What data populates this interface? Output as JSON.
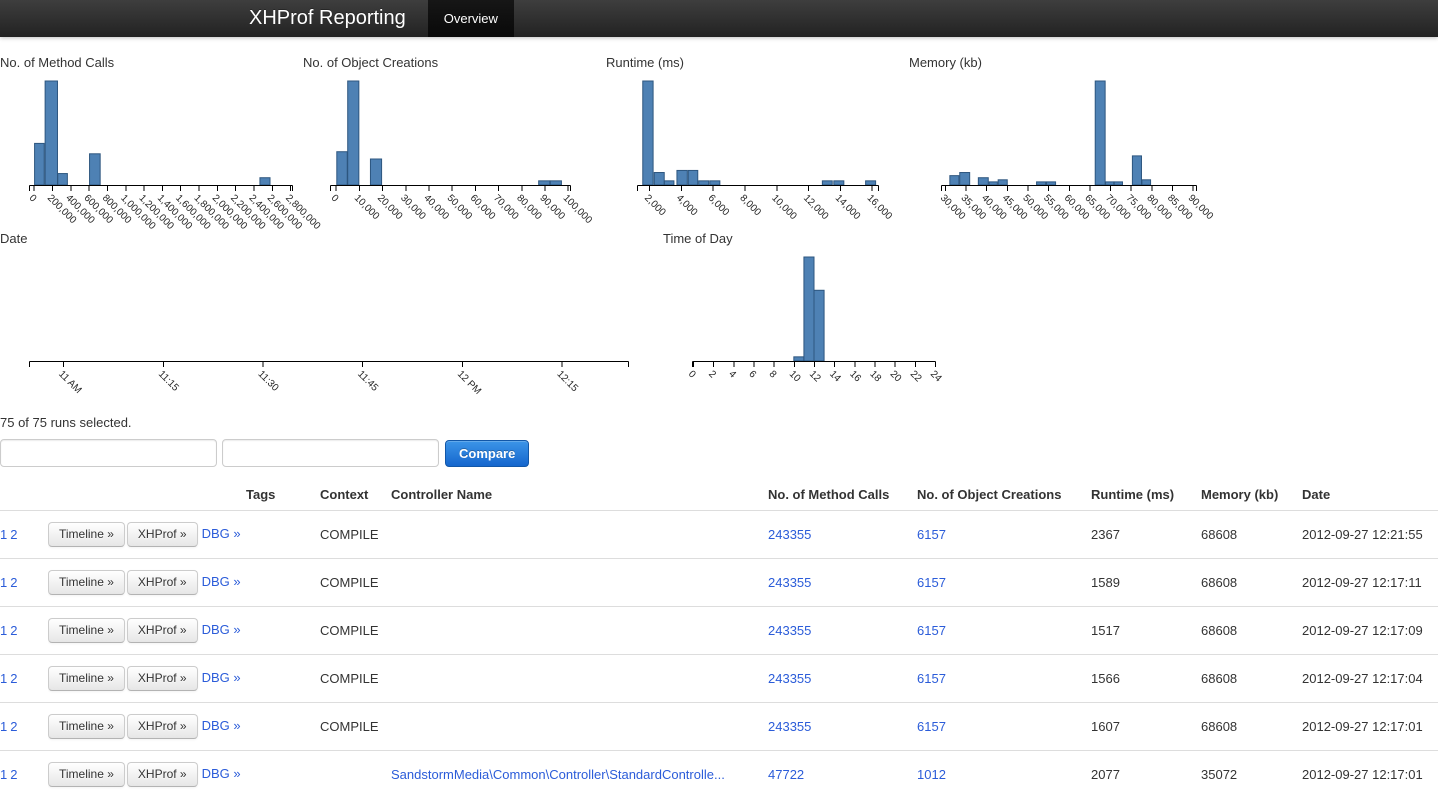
{
  "navbar": {
    "brand": "XHProf Reporting",
    "tabs": [
      {
        "label": "Overview",
        "active": true
      }
    ]
  },
  "selection": {
    "text": "75 of 75 runs selected.",
    "inputs": [
      {
        "value": ""
      },
      {
        "value": ""
      }
    ],
    "compare_label": "Compare"
  },
  "colors": {
    "bar_fill": "#4e81b4",
    "bar_stroke": "#2d567f",
    "link_blue": "#2b5cd9",
    "compare_button_top": "#3c95e8",
    "compare_button_bottom": "#1566cd",
    "navbar_dark": "#222222"
  },
  "chart_data": [
    {
      "id": "method-calls",
      "type": "bar",
      "title": "No. of Method Calls",
      "xmin": -40000,
      "xmax": 2820000,
      "ylim_pct": [
        0,
        100
      ],
      "grid": false,
      "ticks": [
        [
          0,
          "0"
        ],
        [
          200000,
          "200,000"
        ],
        [
          400000,
          "400,000"
        ],
        [
          600000,
          "600,000"
        ],
        [
          800000,
          "800,000"
        ],
        [
          1000000,
          "1,000,000"
        ],
        [
          1200000,
          "1,200,000"
        ],
        [
          1400000,
          "1,400,000"
        ],
        [
          1600000,
          "1,600,000"
        ],
        [
          1800000,
          "1,800,000"
        ],
        [
          2000000,
          "2,000,000"
        ],
        [
          2200000,
          "2,200,000"
        ],
        [
          2400000,
          "2,400,000"
        ],
        [
          2600000,
          "2,600,000"
        ],
        [
          2800000,
          "2,800,000"
        ]
      ],
      "bars": [
        [
          10000,
          115000,
          40
        ],
        [
          125000,
          260000,
          100
        ],
        [
          263000,
          368000,
          11
        ],
        [
          610000,
          726000,
          30
        ],
        [
          2470000,
          2580000,
          7
        ]
      ]
    },
    {
      "id": "object-creations",
      "type": "bar",
      "title": "No. of Object Creations",
      "xmin": -2000,
      "xmax": 101000,
      "ylim_pct": [
        0,
        100
      ],
      "grid": false,
      "ticks": [
        [
          0,
          "0"
        ],
        [
          10000,
          "10,000"
        ],
        [
          20000,
          "20,000"
        ],
        [
          30000,
          "30,000"
        ],
        [
          40000,
          "40,000"
        ],
        [
          50000,
          "50,000"
        ],
        [
          60000,
          "60,000"
        ],
        [
          70000,
          "70,000"
        ],
        [
          80000,
          "80,000"
        ],
        [
          90000,
          "90,000"
        ],
        [
          100000,
          "100,000"
        ]
      ],
      "bars": [
        [
          500,
          5000,
          32
        ],
        [
          5200,
          10000,
          100
        ],
        [
          15000,
          19800,
          25
        ],
        [
          87500,
          92300,
          4
        ],
        [
          92500,
          97300,
          4
        ]
      ]
    },
    {
      "id": "runtime",
      "type": "bar",
      "title": "Runtime (ms)",
      "xmin": 1300,
      "xmax": 16400,
      "ylim_pct": [
        0,
        100
      ],
      "grid": false,
      "ticks": [
        [
          2000,
          "2,000"
        ],
        [
          4000,
          "4,000"
        ],
        [
          6000,
          "6,000"
        ],
        [
          8000,
          "8,000"
        ],
        [
          10000,
          "10,000"
        ],
        [
          12000,
          "12,000"
        ],
        [
          14000,
          "14,000"
        ],
        [
          16000,
          "16,000"
        ]
      ],
      "bars": [
        [
          1600,
          2250,
          100
        ],
        [
          2320,
          2950,
          12
        ],
        [
          2960,
          3560,
          4
        ],
        [
          3750,
          4400,
          14
        ],
        [
          4460,
          5060,
          14
        ],
        [
          5120,
          5750,
          4
        ],
        [
          5820,
          6450,
          4
        ],
        [
          12900,
          13520,
          4
        ],
        [
          13620,
          14250,
          4
        ],
        [
          15620,
          16250,
          4
        ]
      ]
    },
    {
      "id": "memory",
      "type": "bar",
      "title": "Memory (kb)",
      "xmin": 29300,
      "xmax": 90800,
      "ylim_pct": [
        0,
        100
      ],
      "grid": false,
      "ticks": [
        [
          30000,
          "30,000"
        ],
        [
          35000,
          "35,000"
        ],
        [
          40000,
          "40,000"
        ],
        [
          45000,
          "45,000"
        ],
        [
          50000,
          "50,000"
        ],
        [
          55000,
          "55,000"
        ],
        [
          60000,
          "60,000"
        ],
        [
          65000,
          "65,000"
        ],
        [
          70000,
          "70,000"
        ],
        [
          75000,
          "75,000"
        ],
        [
          80000,
          "80,000"
        ],
        [
          85000,
          "85,000"
        ],
        [
          90000,
          "90,000"
        ]
      ],
      "bars": [
        [
          31200,
          33400,
          9
        ],
        [
          33600,
          36000,
          12
        ],
        [
          38100,
          40500,
          7
        ],
        [
          40700,
          42700,
          3
        ],
        [
          42900,
          45100,
          5
        ],
        [
          52200,
          54400,
          3
        ],
        [
          54600,
          56800,
          3
        ],
        [
          66400,
          68800,
          100
        ],
        [
          68900,
          70900,
          3
        ],
        [
          71000,
          73000,
          3
        ],
        [
          75400,
          77600,
          28
        ],
        [
          77700,
          79800,
          5
        ]
      ]
    },
    {
      "id": "date",
      "type": "bar",
      "title": "Date",
      "xmin": 0,
      "xmax": 90,
      "ylim_pct": [
        0,
        100
      ],
      "grid": false,
      "ticks": [
        [
          5,
          "11 AM"
        ],
        [
          20,
          "11:15"
        ],
        [
          35,
          "11:30"
        ],
        [
          50,
          "11:45"
        ],
        [
          65,
          "12 PM"
        ],
        [
          80,
          "12:15"
        ]
      ],
      "bars": []
    },
    {
      "id": "time-of-day",
      "type": "bar",
      "title": "Time of Day",
      "xmin": 0,
      "xmax": 24,
      "ylim_pct": [
        0,
        100
      ],
      "grid": false,
      "ticks": [
        [
          0,
          "0"
        ],
        [
          2,
          "2"
        ],
        [
          4,
          "4"
        ],
        [
          6,
          "6"
        ],
        [
          8,
          "8"
        ],
        [
          10,
          "10"
        ],
        [
          12,
          "12"
        ],
        [
          14,
          "14"
        ],
        [
          16,
          "16"
        ],
        [
          18,
          "18"
        ],
        [
          20,
          "20"
        ],
        [
          22,
          "22"
        ],
        [
          24,
          "24"
        ]
      ],
      "bars": [
        [
          10,
          11,
          4
        ],
        [
          11,
          12,
          100
        ],
        [
          12,
          13,
          68
        ]
      ]
    }
  ],
  "table": {
    "headers": [
      "",
      "",
      "Tags",
      "Context",
      "Controller Name",
      "No. of Method Calls",
      "No. of Object Creations",
      "Runtime (ms)",
      "Memory (kb)",
      "Date"
    ],
    "row_links": {
      "page1": "1",
      "page2": "2",
      "timeline": "Timeline »",
      "xhprof": "XHProf »",
      "dbg": "DBG »"
    },
    "rows": [
      {
        "tags": "",
        "context": "COMPILE",
        "controller": "",
        "method_calls": "243355",
        "object_creations": "6157",
        "runtime": "2367",
        "memory": "68608",
        "date": "2012-09-27 12:21:55"
      },
      {
        "tags": "",
        "context": "COMPILE",
        "controller": "",
        "method_calls": "243355",
        "object_creations": "6157",
        "runtime": "1589",
        "memory": "68608",
        "date": "2012-09-27 12:17:11"
      },
      {
        "tags": "",
        "context": "COMPILE",
        "controller": "",
        "method_calls": "243355",
        "object_creations": "6157",
        "runtime": "1517",
        "memory": "68608",
        "date": "2012-09-27 12:17:09"
      },
      {
        "tags": "",
        "context": "COMPILE",
        "controller": "",
        "method_calls": "243355",
        "object_creations": "6157",
        "runtime": "1566",
        "memory": "68608",
        "date": "2012-09-27 12:17:04"
      },
      {
        "tags": "",
        "context": "COMPILE",
        "controller": "",
        "method_calls": "243355",
        "object_creations": "6157",
        "runtime": "1607",
        "memory": "68608",
        "date": "2012-09-27 12:17:01"
      },
      {
        "tags": "",
        "context": "",
        "controller": "SandstormMedia\\Common\\Controller\\StandardControlle...",
        "method_calls": "47722",
        "object_creations": "1012",
        "runtime": "2077",
        "memory": "35072",
        "date": "2012-09-27 12:17:01"
      }
    ]
  }
}
